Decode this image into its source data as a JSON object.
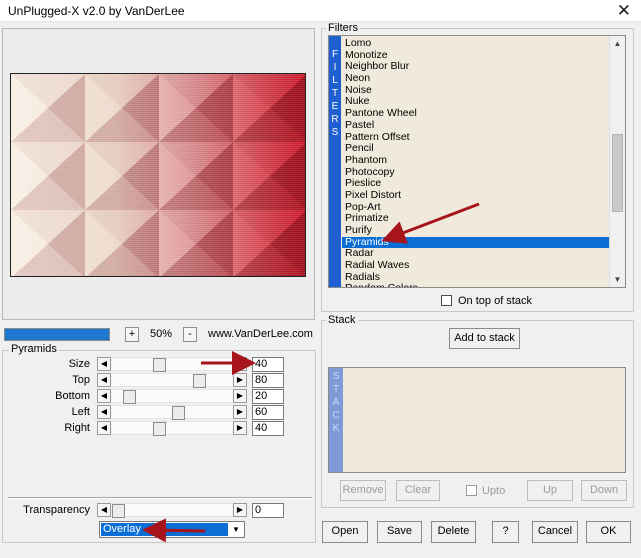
{
  "window": {
    "title": "UnPlugged-X v2.0 by VanDerLee",
    "close_glyph": "✕"
  },
  "preview": {
    "progress_fraction": 1.0,
    "zoom_minus": "+",
    "zoom_value": "50%",
    "zoom_plus": "-",
    "site": "www.VanDerLee.com"
  },
  "params": {
    "group_title": "Pyramids",
    "rows": [
      {
        "label": "Size",
        "value": "40",
        "fraction": 0.38
      },
      {
        "label": "Top",
        "value": "80",
        "fraction": 0.76
      },
      {
        "label": "Bottom",
        "value": "20",
        "fraction": 0.1
      },
      {
        "label": "Left",
        "value": "60",
        "fraction": 0.56
      },
      {
        "label": "Right",
        "value": "40",
        "fraction": 0.38
      }
    ],
    "transparency": {
      "label": "Transparency",
      "value": "0",
      "fraction": 0.0
    },
    "blend_mode": "Overlay"
  },
  "filters": {
    "group_title": "Filters",
    "side_label": "FILTERS",
    "items": [
      "Lomo",
      "Monotize",
      "Neighbor Blur",
      "Neon",
      "Noise",
      "Nuke",
      "Pantone Wheel",
      "Pastel",
      "Pattern Offset",
      "Pencil",
      "Phantom",
      "Photocopy",
      "Pieslice",
      "Pixel Distort",
      "Pop-Art",
      "Primatize",
      "Purify",
      "Pyramids",
      "Radar",
      "Radial Waves",
      "Radials",
      "Random Colors"
    ],
    "selected": "Pyramids",
    "on_top_label": "On top of stack"
  },
  "stack": {
    "group_title": "Stack",
    "side_label": "STACK",
    "add_label": "Add to stack",
    "remove_label": "Remove",
    "clear_label": "Clear",
    "upto_label": "Upto",
    "up_label": "Up",
    "down_label": "Down"
  },
  "footer": {
    "open": "Open",
    "save": "Save",
    "delete": "Delete",
    "help": "?",
    "cancel": "Cancel",
    "ok": "OK"
  },
  "colors": {
    "accent": "#0a6ed6",
    "filter_bar": "#1f5fcf",
    "stack_bar": "#7f9bd7",
    "annotation": "#a8141b"
  }
}
